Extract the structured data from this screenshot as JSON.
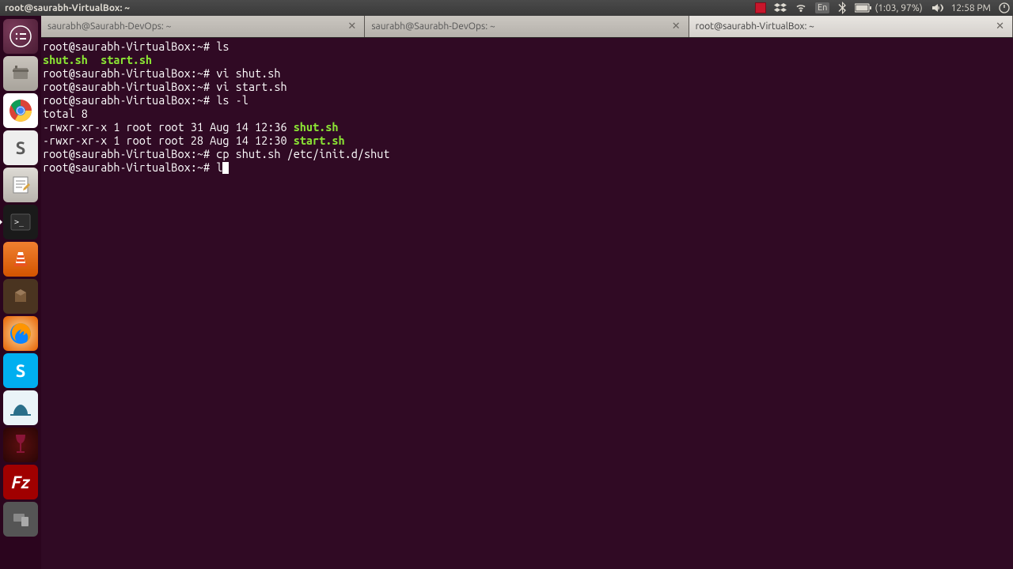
{
  "topbar": {
    "title": "root@saurabh-VirtualBox: ~",
    "language": "En",
    "battery": "(1:03, 97%)",
    "time": "12:58 PM"
  },
  "tabs": [
    {
      "label": "saurabh@Saurabh-DevOps: ~",
      "active": false
    },
    {
      "label": "saurabh@Saurabh-DevOps: ~",
      "active": false
    },
    {
      "label": "root@saurabh-VirtualBox: ~",
      "active": true
    }
  ],
  "terminal": {
    "prompt": "root@saurabh-VirtualBox:~#",
    "lines": {
      "cmd_ls": "ls",
      "ls_out1": "shut.sh",
      "ls_out2": "start.sh",
      "cmd_vi1": "vi shut.sh",
      "cmd_vi2": "vi start.sh",
      "cmd_lsl": "ls -l",
      "total": "total 8",
      "row1_meta": "-rwxr-xr-x 1 root root 31 Aug 14 12:36 ",
      "row1_file": "shut.sh",
      "row2_meta": "-rwxr-xr-x 1 root root 28 Aug 14 12:30 ",
      "row2_file": "start.sh",
      "cmd_cp": "cp shut.sh /etc/init.d/shut",
      "cmd_partial": "l"
    }
  },
  "launcher": {
    "items": [
      "dash",
      "files",
      "chrome",
      "sublime",
      "gedit",
      "terminal",
      "vlc",
      "software",
      "firefox",
      "skype",
      "workbench",
      "wine",
      "filezilla",
      "devices"
    ]
  }
}
